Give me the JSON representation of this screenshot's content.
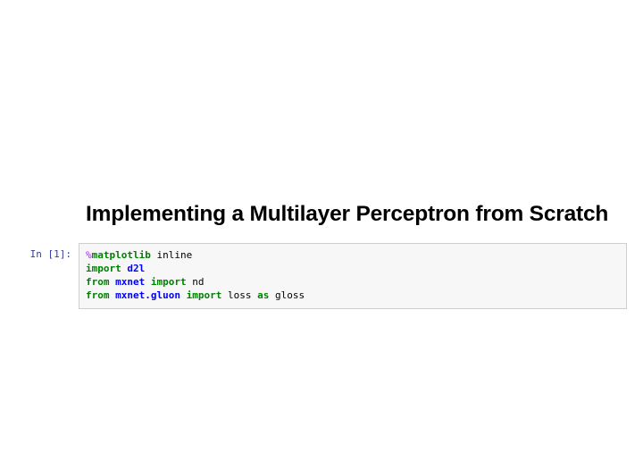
{
  "title": "Implementing a Multilayer Perceptron from Scratch",
  "cell": {
    "prompt": "In [1]:",
    "lines": {
      "l0": {
        "pct": "%",
        "magic": "matplotlib",
        "sp0": " ",
        "rest": "inline"
      },
      "l1": {
        "kw0": "import",
        "sp0": " ",
        "mod0": "d2l"
      },
      "l2": {
        "kw0": "from",
        "sp0": " ",
        "mod0": "mxnet",
        "sp1": " ",
        "kw1": "import",
        "sp2": " ",
        "name0": "nd"
      },
      "l3": {
        "kw0": "from",
        "sp0": " ",
        "mod0": "mxnet.gluon",
        "sp1": " ",
        "kw1": "import",
        "sp2": " ",
        "name0": "loss",
        "sp3": " ",
        "kw2": "as",
        "sp4": " ",
        "name1": "gloss"
      }
    }
  }
}
